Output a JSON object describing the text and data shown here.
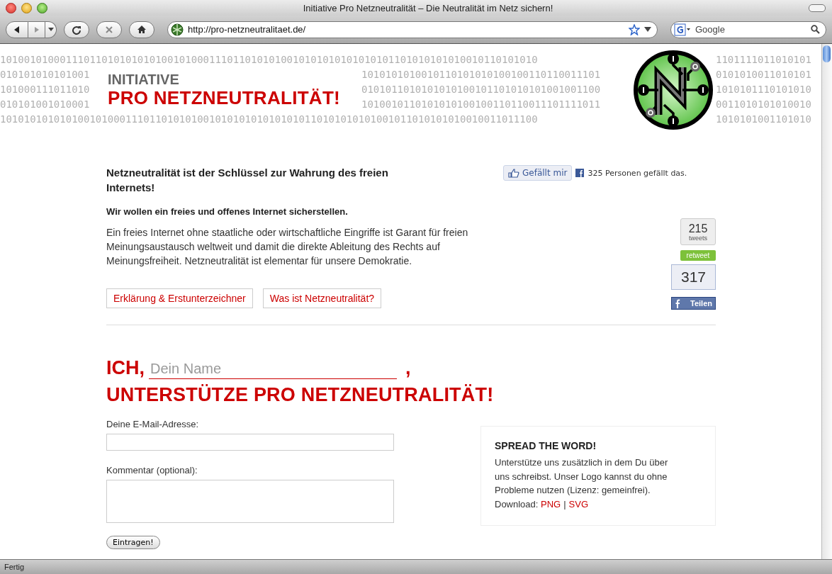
{
  "window": {
    "title": "Initiative Pro Netzneutralität – Die Neutralität im Netz sichern!"
  },
  "toolbar": {
    "url": "http://pro-netzneutralitaet.de/",
    "search": {
      "placeholder": "Google"
    }
  },
  "header": {
    "binary_rows": [
      [
        "101001010001110110101010101001010001110110101010010101010101010101101010101010010110101010",
        "1101111011010101"
      ],
      [
        "010101010101001",
        "1010101010010110101010100100110110011101",
        "0101010011010101"
      ],
      [
        "101000111011010",
        "0101011010101010100101101010101001001100",
        "1010101110101010"
      ],
      [
        "010101001010001",
        "1010010110101010100100110110011101111011",
        "0011010101010010"
      ],
      [
        "101010101010100101000111011010101001010101010101010110101010101001011010101010010011011100",
        "1010101001101010"
      ]
    ],
    "kicker": "INITIATIVE",
    "title": "PRO NETZNEUTRALITÄT!"
  },
  "intro": {
    "heading": "Netzneutralität ist der Schlüssel zur Wahrung des freien Internets!",
    "lead": "Wir wollen ein freies und offenes Internet sicherstellen.",
    "body": "Ein freies Internet ohne staatliche oder wirtschaftliche Eingriffe ist Garant für freien Meinungsaustausch weltweit und damit die direkte Ableitung des Rechts auf Meinungsfreiheit. Netzneutralität ist elementar für unsere Demokratie.",
    "buttons": [
      "Erklärung & Erstunterzeichner",
      "Was ist Netzneutralität?"
    ]
  },
  "facebook": {
    "like_label": "Gefällt mir",
    "like_count": "325 Personen gefällt das.",
    "share_count": "317",
    "share_label": "Teilen"
  },
  "twitter": {
    "count": "215",
    "unit": "tweets",
    "button": "retweet"
  },
  "pledge": {
    "prefix": "ICH,",
    "name_placeholder": "Dein Name",
    "suffix": ",",
    "headline": "UNTERSTÜTZE PRO NETZNEUTRALITÄT!"
  },
  "form": {
    "fields": [
      {
        "kind": "input",
        "label": "Deine E-Mail-Adresse:"
      },
      {
        "kind": "textarea",
        "label": "Kommentar (optional):"
      }
    ],
    "submit": "Eintragen!"
  },
  "spread": {
    "title": "SPREAD THE WORD!",
    "text": "Unterstütze uns zusätzlich in dem Du über uns schreibst. Unser Logo kannst du ohne Probleme nutzen (Lizenz: gemeinfrei). Download:",
    "links": [
      "PNG",
      "SVG"
    ],
    "separator": "|"
  },
  "status_bar": {
    "text": "Fertig"
  }
}
